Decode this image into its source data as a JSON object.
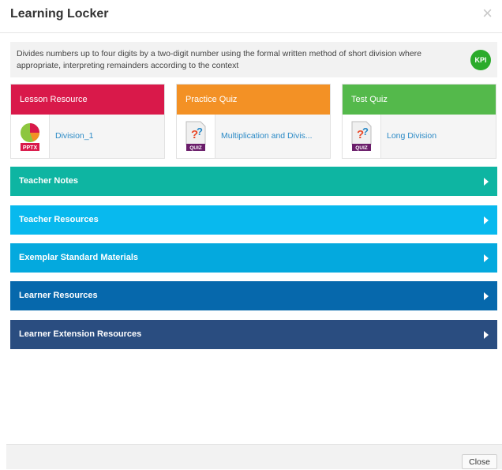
{
  "modal": {
    "title": "Learning Locker",
    "close_symbol": "×"
  },
  "kpi": {
    "text": "Divides numbers up to four digits by a two-digit number using the formal written method of short division where appropriate, interpreting remainders according to the context",
    "badge": "KPI",
    "badge_color": "#2bab2b"
  },
  "cards": [
    {
      "header": "Lesson Resource",
      "color": "#d9194a",
      "icon": "pptx-file-icon",
      "icon_label": "PPTX",
      "link": "Division_1"
    },
    {
      "header": "Practice Quiz",
      "color": "#f39125",
      "icon": "quiz-file-icon",
      "icon_label": "QUIZ",
      "link": "Multiplication and Divis..."
    },
    {
      "header": "Test Quiz",
      "color": "#54b94b",
      "icon": "quiz-file-icon",
      "icon_label": "QUIZ",
      "link": "Long Division"
    }
  ],
  "sections": [
    {
      "label": "Teacher Notes",
      "color": "#0eb5a2"
    },
    {
      "label": "Teacher Resources",
      "color": "#08b9ee"
    },
    {
      "label": "Exemplar Standard Materials",
      "color": "#04a9de"
    },
    {
      "label": "Learner Resources",
      "color": "#0668ac"
    },
    {
      "label": "Learner Extension Resources",
      "color": "#2a4d80"
    }
  ],
  "footer": {
    "close_label": "Close"
  }
}
